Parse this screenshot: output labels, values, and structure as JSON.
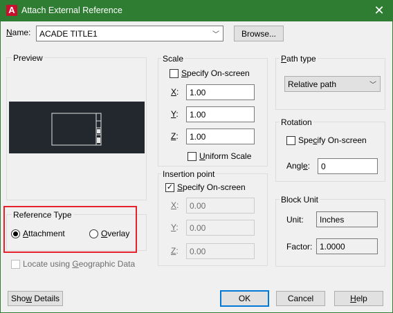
{
  "window": {
    "title": "Attach External Reference",
    "logo_letter": "A",
    "close_glyph": "✕"
  },
  "name_row": {
    "label_prefix": "",
    "label_accel": "N",
    "label_rest": "ame:",
    "value": "ACADE TITLE1",
    "browse_label": "Browse..."
  },
  "preview": {
    "title": "Preview"
  },
  "scale": {
    "title": "Scale",
    "specify_accel": "S",
    "specify_rest": "pecify On-screen",
    "specify_checked": false,
    "x_accel": "X",
    "x_value": "1.00",
    "y_accel": "Y",
    "y_value": "1.00",
    "z_accel": "Z",
    "z_value": "1.00",
    "uniform_accel": "U",
    "uniform_rest": "niform Scale",
    "uniform_checked": false,
    "colon": ":"
  },
  "insertion": {
    "title": "Insertion point",
    "specify_accel": "S",
    "specify_rest": "pecify On-screen",
    "specify_checked": true,
    "check_glyph": "✓",
    "x_accel": "X",
    "x_value": "0.00",
    "y_accel": "Y",
    "y_value": "0.00",
    "z_accel": "Z",
    "z_value": "0.00",
    "colon": ":"
  },
  "path_type": {
    "title_accel": "P",
    "title_rest": "ath type",
    "value": "Relative path"
  },
  "rotation": {
    "title": "Rotation",
    "specify_pre": "Spe",
    "specify_accel": "c",
    "specify_rest": "ify On-screen",
    "specify_checked": false,
    "angle_pre": "Angl",
    "angle_accel": "e",
    "angle_rest": ":",
    "angle_value": "0"
  },
  "block_unit": {
    "title": "Block Unit",
    "unit_label": "Unit:",
    "unit_value": "Inches",
    "factor_label": "Factor:",
    "factor_value": "1.0000"
  },
  "reference_type": {
    "title": "Reference Type",
    "attachment_accel": "A",
    "attachment_rest": "ttachment",
    "overlay_accel": "O",
    "overlay_rest": "verlay",
    "selected": "attachment"
  },
  "geo": {
    "pre": "Locate using ",
    "accel": "G",
    "rest": "eographic Data",
    "checked": false
  },
  "buttons": {
    "show_details_pre": "Sho",
    "show_details_accel": "w",
    "show_details_rest": " Details",
    "ok": "OK",
    "cancel": "Cancel",
    "help_accel": "H",
    "help_rest": "elp"
  },
  "icons": {
    "dropdown_arrow": "﹀"
  },
  "colors": {
    "title_bar": "#2e7d32",
    "highlight": "#e8202a",
    "default_button_border": "#0078d7",
    "preview_background": "#23282f"
  }
}
